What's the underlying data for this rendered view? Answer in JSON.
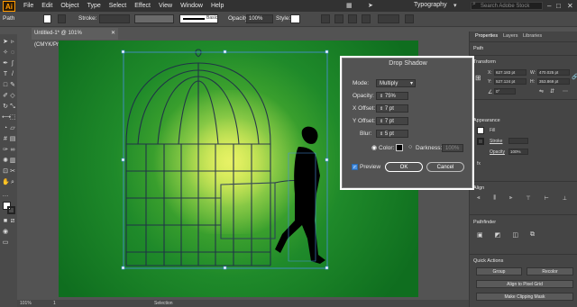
{
  "menubar": {
    "logo": "Ai",
    "items": [
      "File",
      "Edit",
      "Object",
      "Type",
      "Select",
      "Effect",
      "View",
      "Window",
      "Help"
    ],
    "workspace": "Typography",
    "search_placeholder": "Search Adobe Stock"
  },
  "controlbar": {
    "selection_label": "Path",
    "stroke_label": "Stroke:",
    "brush_label": "Basic",
    "opacity_label": "Opacity:",
    "opacity_value": "100%",
    "style_label": "Style:"
  },
  "document": {
    "tab_title": "Untitled-1* @ 101% (CMYK/Preview)"
  },
  "statusbar": {
    "zoom": "101%",
    "page": "1",
    "tool": "Selection"
  },
  "panel": {
    "tabs": [
      "Properties",
      "Layers",
      "Libraries"
    ],
    "selection_type": "Path",
    "transform": {
      "header": "Transform",
      "x_label": "X:",
      "x_value": "627.183 pt",
      "y_label": "Y:",
      "y_value": "527.124 pt",
      "w_label": "W:",
      "w_value": "470.025 pt",
      "h_label": "H:",
      "h_value": "353.869 pt",
      "angle_value": "0°"
    },
    "appearance": {
      "header": "Appearance",
      "fill_label": "Fill",
      "stroke_label": "Stroke",
      "opacity_label": "Opacity",
      "opacity_value": "100%",
      "fx_label": "fx"
    },
    "align_header": "Align",
    "pathfinder_header": "Pathfinder",
    "quick_actions": {
      "header": "Quick Actions",
      "group": "Group",
      "recolor": "Recolor",
      "align_pixel": "Align to Pixel Grid",
      "clip_mask": "Make Clipping Mask"
    }
  },
  "dialog": {
    "title": "Drop Shadow",
    "mode_label": "Mode:",
    "mode_value": "Multiply",
    "opacity_label": "Opacity:",
    "opacity_value": "75%",
    "xoffset_label": "X Offset:",
    "xoffset_value": "7 pt",
    "yoffset_label": "Y Offset:",
    "yoffset_value": "7 pt",
    "blur_label": "Blur:",
    "blur_value": "5 pt",
    "color_label": "Color:",
    "darkness_label": "Darkness:",
    "darkness_value": "100%",
    "preview_label": "Preview",
    "ok_label": "OK",
    "cancel_label": "Cancel",
    "shadow_color": "#000000"
  },
  "colors": {
    "accent": "#4a90e2",
    "artboard_center": "#d7ec3f",
    "artboard_mid": "#4fb030",
    "artboard_edge": "#0f6e1f"
  }
}
